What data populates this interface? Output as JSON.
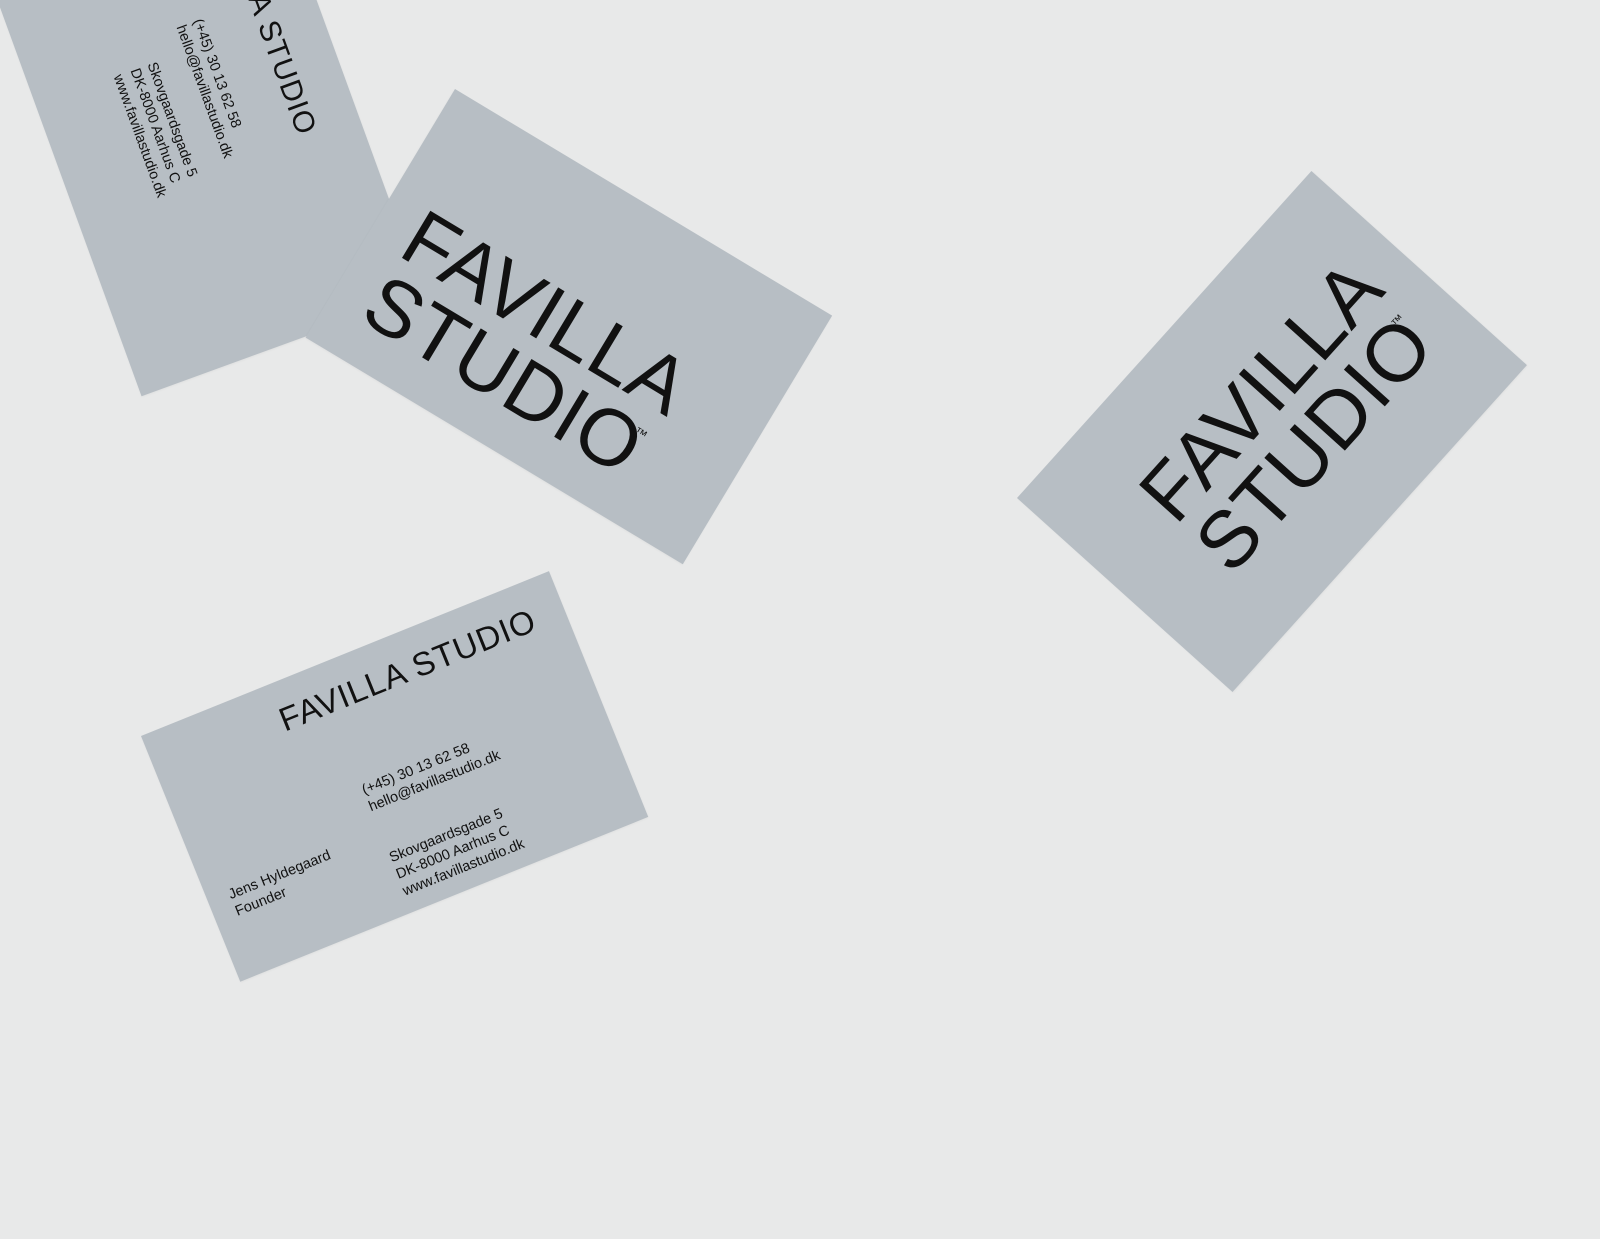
{
  "brand": {
    "line1": "FAVILLA",
    "line2": "STUDIO",
    "inline": "FAVILLA STUDIO",
    "tm": "™"
  },
  "contact": {
    "name": "Jens Hyldegaard",
    "role": "Founder",
    "phone": "(+45) 30 13 62 58",
    "email": "hello@favillastudio.dk",
    "street": "Skovgaardsgade 5",
    "city": "DK-8000 Aarhus C",
    "web": "www.favillastudio.dk"
  },
  "colors": {
    "background": "#e8e9e9",
    "card": "#b7bec4",
    "ink": "#111111"
  }
}
